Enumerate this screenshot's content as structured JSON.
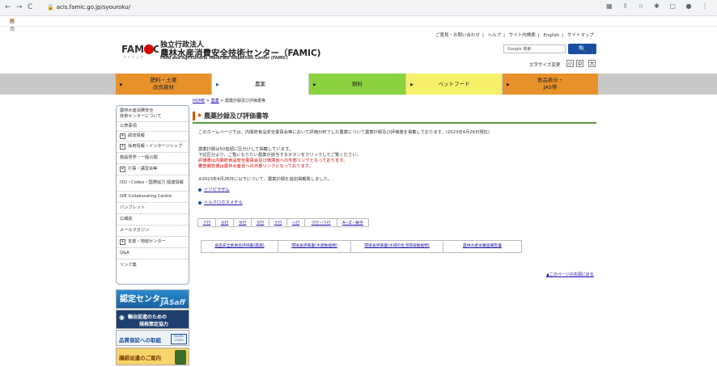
{
  "browser": {
    "nav_icons": [
      "←",
      "→",
      "C"
    ],
    "url": "acis.famic.go.jp/syouroku/",
    "bookmarks_label": "応用"
  },
  "header": {
    "logo_text": "FAMIC",
    "org_name_jp_line1": "独立行政法人",
    "org_name_jp_line2": "農林水産消費安全技術センター（FAMIC)",
    "org_name_en": "Food and Agricultural Materials Inspection Center (FAMIC)",
    "links": [
      "ご意見・お問い合わせ",
      "ヘルプ",
      "サイト内検索",
      "English",
      "サイトマップ"
    ],
    "search_placeholder": "Google 検索",
    "search_button": "🔍",
    "font_size_label": "文字サイズ変更",
    "font_sizes": [
      "小",
      "中",
      "大"
    ]
  },
  "nav": {
    "items": [
      {
        "label": "肥料・土壌\n改良資材",
        "color": "#e8912a"
      },
      {
        "label": "農薬",
        "color": "#ffffff"
      },
      {
        "label": "飼料",
        "color": "#8bd23e"
      },
      {
        "label": "ペットフード",
        "color": "#f6f069"
      },
      {
        "label": "食品表示・\nJAS等",
        "color": "#e8912a"
      }
    ]
  },
  "breadcrumb": {
    "home": "HOME",
    "sep": ">",
    "level1": "農薬",
    "current": "農薬抄録及び評価書等"
  },
  "sidebar": {
    "items": [
      {
        "label": "農林水産消費安全\n技術センターについて",
        "expand": false
      },
      {
        "label": "公表事項",
        "expand": false
      },
      {
        "label": "調達情報",
        "expand": true
      },
      {
        "label": "採用情報・インターンシップ",
        "expand": true
      },
      {
        "label": "施設見学・一般公開",
        "expand": false
      },
      {
        "label": "行事・講習会等",
        "expand": true
      },
      {
        "label": "ISO・Codex・国際協力 関連情報",
        "expand": false
      },
      {
        "label": "OIE Collaborating Centre",
        "expand": false
      },
      {
        "label": "パンフレット",
        "expand": false
      },
      {
        "label": "広報誌",
        "expand": false
      },
      {
        "label": "メールマガジン",
        "expand": false
      },
      {
        "label": "本部・地域センター",
        "expand": true
      },
      {
        "label": "Q&A",
        "expand": false
      },
      {
        "label": "リンク集",
        "expand": false
      }
    ],
    "banners": [
      {
        "label": "認定センター",
        "sub": "JASaff"
      },
      {
        "label": "輸出促進のための",
        "sub": "規格策定協力"
      },
      {
        "label": "品質保証への取組",
        "sub": "ISO/IEC 17025"
      },
      {
        "label": "講師派遣のご案内",
        "sub": ""
      }
    ]
  },
  "main": {
    "title": "農薬抄録及び評価書等",
    "intro": "このホームページでは、内閣府食品安全委員会等において評価が終了した農薬について農薬抄録及び評価書を掲載しております。(2023年4月26日現在)",
    "para_lines": [
      "農薬抄録は50音順に区分けして掲載しています。",
      "下記区分より、ご覧になりたい農薬が該当するボタンをクリックしてご覧ください。"
    ],
    "red_lines": [
      "評価書は内閣府食品安全委員会及び環境省への外部リンクとなっております。",
      "審査報告書は農林水産省への外部リンクとなっております。"
    ],
    "notice": "※2023年4月26日に以下について、農薬抄録を追加掲載致しました。",
    "new_items": [
      "イソピラザム",
      "トルクロホスメチル"
    ],
    "kana_tabs": [
      "ア行",
      "カ行",
      "サ行",
      "タ行",
      "ナ行",
      "ハ行",
      "マ行～ワ行",
      "A～Z・数字"
    ],
    "doc_tabs": [
      {
        "line1": "食品安全委員会評価書",
        "line2": "(農薬)"
      },
      {
        "line1": "環境省評価書",
        "line2": "(水産動植物)"
      },
      {
        "line1": "環境省評価書",
        "line2": "(水域の生活環境動植物)"
      },
      {
        "line1": "農林水産省",
        "line2": "審査報告書"
      }
    ],
    "back_to_top": "▲このページの先頭に戻る"
  }
}
